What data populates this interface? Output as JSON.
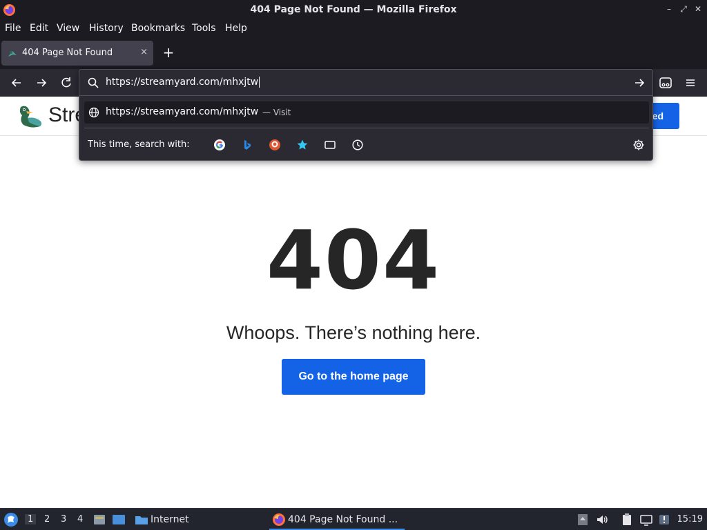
{
  "window": {
    "title": "404 Page Not Found — Mozilla Firefox"
  },
  "menu": [
    "File",
    "Edit",
    "View",
    "History",
    "Bookmarks",
    "Tools",
    "Help"
  ],
  "tab": {
    "label": "404 Page Not Found",
    "close": "×",
    "new_tab": "+"
  },
  "urlbar": {
    "value": "https://streamyard.com/mhxjtw",
    "suggestion_url": "https://streamyard.com/mhxjtw",
    "suggestion_action": "— Visit",
    "search_with_label": "This time, search with:",
    "engines": [
      "google-icon",
      "bing-icon",
      "duckduckgo-icon",
      "bookmarks-icon",
      "tabs-icon",
      "history-icon"
    ]
  },
  "page": {
    "brand": "Stre",
    "cta_label": "ted",
    "error_code": "404",
    "message": "Whoops. There’s nothing here.",
    "home_button": "Go to the home page"
  },
  "taskbar": {
    "workspaces": [
      "1",
      "2",
      "3",
      "4"
    ],
    "launcher_label": "Internet",
    "task_label": "404 Page Not Found ...",
    "clock": "15:19"
  },
  "colors": {
    "chrome_dark": "#1c1b22",
    "toolbar": "#2b2a33",
    "accent_blue": "#1463e6",
    "text_dark": "#262626"
  }
}
